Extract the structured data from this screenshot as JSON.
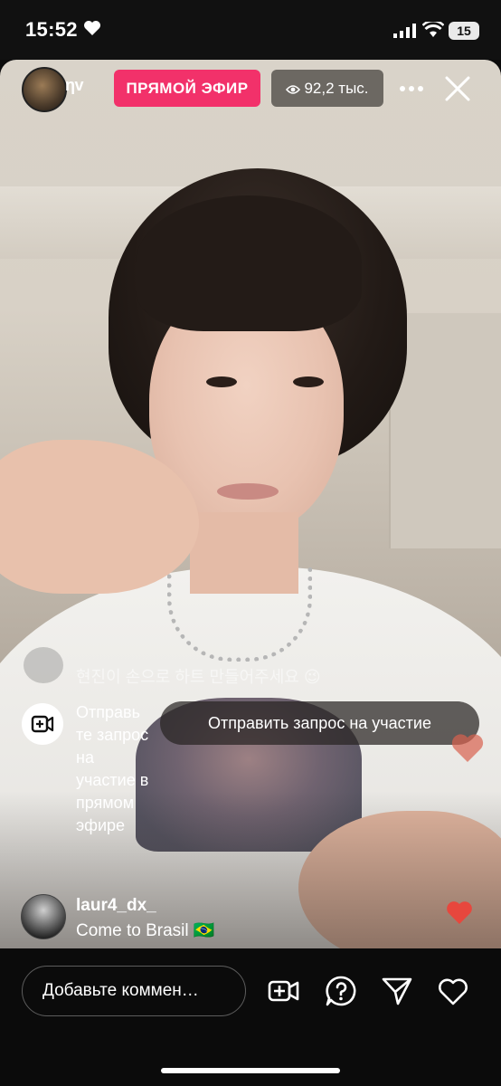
{
  "status_bar": {
    "time": "15:52",
    "battery": "15",
    "icons": [
      "heart-icon",
      "signal-icon",
      "wifi-icon",
      "battery-icon"
    ]
  },
  "live": {
    "username_fragment": "ηv",
    "live_badge": "ПРЯМОЙ ЭФИР",
    "viewers": "92,2 тыс.",
    "accent_color": "#f2316a"
  },
  "comments": {
    "faded": "현진이 손으로 하트 만들어주세요 😉",
    "request_prompt": "Отправь те запрос на участие в прямом эфире",
    "request_button": "Отправить запрос на участие",
    "latest": {
      "user": "laur4_dx_",
      "text": "Come to Brasil 🇧🇷"
    }
  },
  "bottom_bar": {
    "comment_placeholder": "Добавьте коммен…",
    "icons": [
      "video-request-icon",
      "question-icon",
      "send-icon",
      "heart-icon"
    ]
  }
}
